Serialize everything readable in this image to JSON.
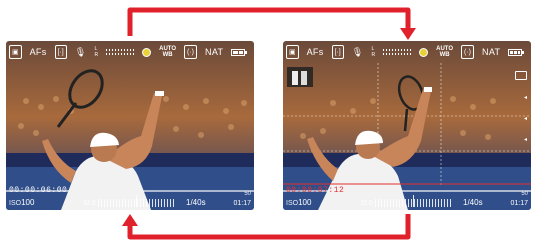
{
  "colors": {
    "arrow": "#e0202a",
    "record": "#e53030"
  },
  "left_screen": {
    "indicators": [
      "AF-icon",
      "AFs",
      "face-detect-icon",
      "microphone-icon",
      "L",
      "R",
      "AUTO",
      "WB",
      "focus-peaking-icon",
      "NAT",
      "battery-icon"
    ],
    "af_label": "AFs",
    "wb_label_top": "AUTO",
    "wb_label_bottom": "WB",
    "mic_l": "L",
    "mic_r": "R",
    "profile": "NAT",
    "timecode": "00:00:06:00",
    "iso_key": "ISO",
    "iso_value": "100",
    "f_number": "f2.0",
    "shutter": "1/40",
    "shutter_unit": "s",
    "remaining": "01:17",
    "fps": "50"
  },
  "right_screen": {
    "af_label": "AFs",
    "wb_label_top": "AUTO",
    "wb_label_bottom": "WB",
    "mic_l": "L",
    "mic_r": "R",
    "profile": "NAT",
    "timecode": "00:00:07:12",
    "iso_key": "ISO",
    "iso_value": "100",
    "f_number": "f2.0",
    "shutter": "1/40",
    "shutter_unit": "s",
    "remaining": "01:17",
    "fps": "50",
    "side_icons": [
      "display-icon",
      "zoom-icon",
      "exposure-icon",
      "level-icon"
    ]
  }
}
